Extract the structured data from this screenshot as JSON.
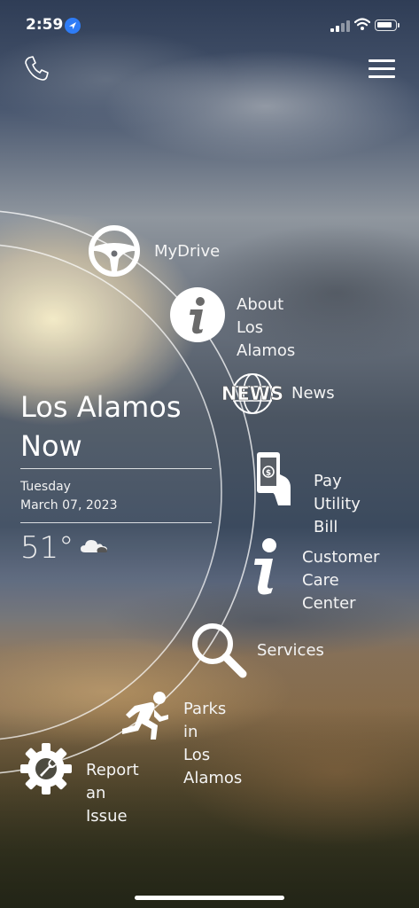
{
  "status_bar": {
    "time": "2:59"
  },
  "header": {
    "phone_icon": "phone-icon",
    "menu_icon": "hamburger-menu-icon"
  },
  "weather": {
    "title": "Los Alamos Now",
    "day": "Tuesday",
    "date": "March 07, 2023",
    "temperature": "51°",
    "condition_icon": "cloudy-icon"
  },
  "menu_items": [
    {
      "label": "MyDrive",
      "icon": "steering-wheel-icon"
    },
    {
      "label": "About Los\nAlamos",
      "icon": "info-circle-icon"
    },
    {
      "label": "News",
      "icon": "news-globe-icon",
      "icon_text": "NEWS"
    },
    {
      "label": "Pay Utility Bill",
      "icon": "phone-payment-icon"
    },
    {
      "label": "Customer\nCare Center",
      "icon": "info-icon"
    },
    {
      "label": "Services",
      "icon": "magnifier-icon"
    },
    {
      "label": "Parks in\nLos Alamos",
      "icon": "runner-icon"
    },
    {
      "label": "Report an Issue",
      "icon": "gear-wrench-icon"
    }
  ]
}
